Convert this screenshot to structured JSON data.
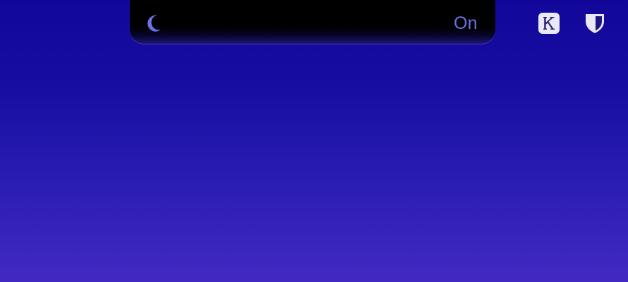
{
  "notch": {
    "icon": "moon-icon",
    "status": "On",
    "status_color": "#6a72e6"
  },
  "menubar": {
    "icons": [
      "k-app-icon",
      "shield-icon"
    ]
  },
  "colors": {
    "background_top": "#12079a",
    "background_bottom": "#4229c2",
    "icon_light": "#e8e8f7",
    "moon": "#6a72e6"
  }
}
